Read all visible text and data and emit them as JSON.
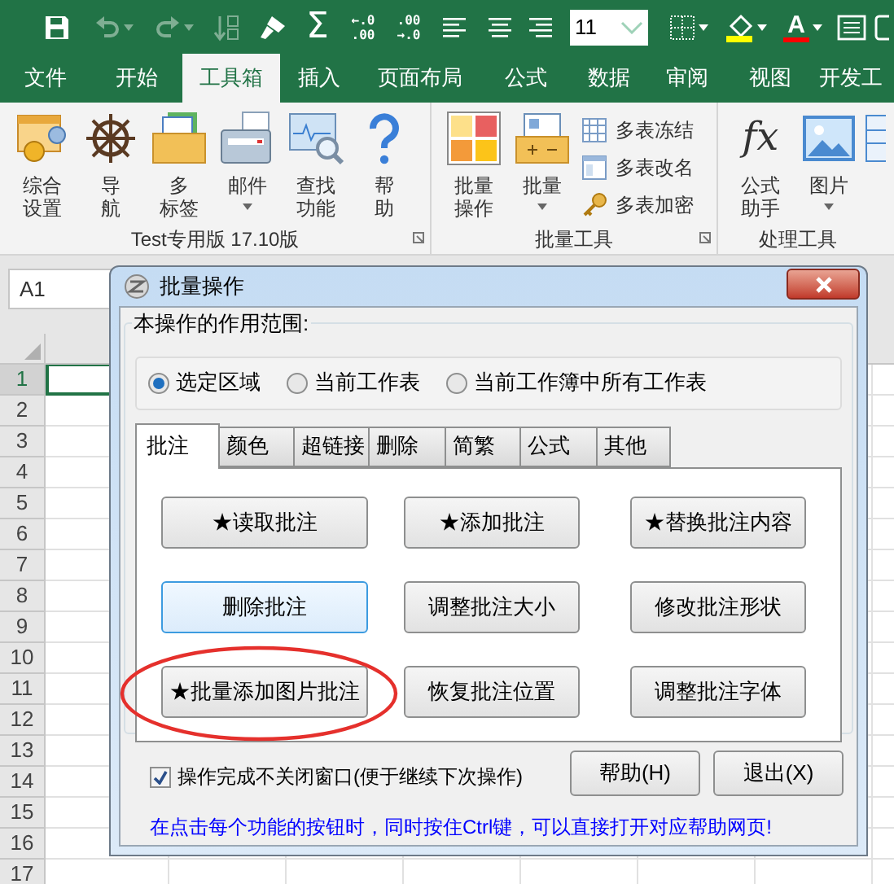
{
  "quick_access": [
    {
      "kind": "save",
      "disabled": false
    },
    {
      "kind": "undo",
      "disabled": true,
      "dropdown": true
    },
    {
      "kind": "redo",
      "disabled": true,
      "dropdown": true
    },
    {
      "kind": "sort",
      "disabled": true
    },
    {
      "kind": "brush",
      "disabled": false
    },
    {
      "kind": "glyph",
      "glyph": "Σ",
      "disabled": false
    },
    {
      "kind": "decimal",
      "lines": [
        "←.0",
        ".00"
      ],
      "disabled": false
    },
    {
      "kind": "decimal",
      "lines": [
        ".00",
        "→.0"
      ],
      "disabled": false
    },
    {
      "kind": "align-left",
      "disabled": false
    },
    {
      "kind": "align-center",
      "disabled": false
    },
    {
      "kind": "align-right",
      "disabled": false
    },
    {
      "kind": "font-size",
      "value": "11"
    },
    {
      "kind": "borders",
      "disabled": false,
      "dropdown": true
    },
    {
      "kind": "fill",
      "disabled": false,
      "dropdown": true
    },
    {
      "kind": "font-color",
      "glyph": "A",
      "disabled": false,
      "dropdown": true
    },
    {
      "kind": "wrap",
      "disabled": false
    },
    {
      "kind": "partial",
      "disabled": false
    }
  ],
  "tabs": [
    {
      "label": "文件",
      "selected": false
    },
    {
      "label": "开始",
      "selected": false
    },
    {
      "label": "工具箱",
      "selected": true
    },
    {
      "label": "插入",
      "selected": false
    },
    {
      "label": "页面布局",
      "selected": false
    },
    {
      "label": "公式",
      "selected": false
    },
    {
      "label": "数据",
      "selected": false
    },
    {
      "label": "审阅",
      "selected": false
    },
    {
      "label": "视图",
      "selected": false
    },
    {
      "label": "开发工",
      "selected": false
    }
  ],
  "ribbon_groups": [
    {
      "label": "Test专用版 17.10版",
      "launcher": true,
      "items": [
        {
          "kind": "large",
          "lines": [
            "综合",
            "设置"
          ]
        },
        {
          "kind": "large",
          "lines": [
            "导",
            "航"
          ]
        },
        {
          "kind": "large",
          "lines": [
            "多",
            "标签"
          ]
        },
        {
          "kind": "large",
          "lines": [
            "邮件"
          ],
          "dropdown": true
        },
        {
          "kind": "large",
          "lines": [
            "查找",
            "功能"
          ]
        },
        {
          "kind": "large",
          "lines": [
            "帮",
            "助"
          ]
        }
      ]
    },
    {
      "label": "批量工具",
      "launcher": true,
      "items": [
        {
          "kind": "large",
          "lines": [
            "批量",
            "操作"
          ]
        },
        {
          "kind": "large",
          "lines": [
            "批量"
          ],
          "dropdown": true
        },
        {
          "kind": "small",
          "label": "多表冻结"
        },
        {
          "kind": "small",
          "label": "多表改名"
        },
        {
          "kind": "small",
          "label": "多表加密"
        }
      ]
    },
    {
      "label": "处理工具",
      "items": [
        {
          "kind": "large",
          "glyph": "fx",
          "lines": [
            "公式",
            "助手"
          ]
        },
        {
          "kind": "large",
          "lines": [
            "图片"
          ],
          "dropdown": true
        },
        {
          "kind": "cut"
        }
      ]
    }
  ],
  "name_box": "A1",
  "sheet": {
    "rows": [
      {
        "label": "1",
        "selected": true
      },
      {
        "label": "2",
        "selected": false
      },
      {
        "label": "3",
        "selected": false
      },
      {
        "label": "4",
        "selected": false
      },
      {
        "label": "5",
        "selected": false
      },
      {
        "label": "6",
        "selected": false
      },
      {
        "label": "7",
        "selected": false
      },
      {
        "label": "8",
        "selected": false
      },
      {
        "label": "9",
        "selected": false
      },
      {
        "label": "10",
        "selected": false
      },
      {
        "label": "11",
        "selected": false
      },
      {
        "label": "12",
        "selected": false
      },
      {
        "label": "13",
        "selected": false
      },
      {
        "label": "14",
        "selected": false
      },
      {
        "label": "15",
        "selected": false
      },
      {
        "label": "16",
        "selected": false
      },
      {
        "label": "17",
        "selected": false
      }
    ]
  },
  "dialog": {
    "title": "批量操作",
    "scope_legend": "本操作的作用范围:",
    "scope_options": [
      {
        "label": "选定区域",
        "selected": true
      },
      {
        "label": "当前工作表",
        "selected": false
      },
      {
        "label": "当前工作簿中所有工作表",
        "selected": false
      }
    ],
    "tabs": [
      {
        "label": "批注",
        "selected": true
      },
      {
        "label": "颜色",
        "selected": false
      },
      {
        "label": "超链接",
        "selected": false
      },
      {
        "label": "删除",
        "selected": false
      },
      {
        "label": "简繁",
        "selected": false
      },
      {
        "label": "公式",
        "selected": false
      },
      {
        "label": "其他",
        "selected": false
      }
    ],
    "buttons": [
      {
        "label": "★读取批注",
        "focused": false,
        "circled": false
      },
      {
        "label": "★添加批注",
        "focused": false,
        "circled": false
      },
      {
        "label": "★替换批注内容",
        "focused": false,
        "circled": false
      },
      {
        "label": "删除批注",
        "focused": true,
        "circled": false
      },
      {
        "label": "调整批注大小",
        "focused": false,
        "circled": false
      },
      {
        "label": "修改批注形状",
        "focused": false,
        "circled": false
      },
      {
        "label": "★批量添加图片批注",
        "focused": false,
        "circled": true
      },
      {
        "label": "恢复批注位置",
        "focused": false,
        "circled": false
      },
      {
        "label": "调整批注字体",
        "focused": false,
        "circled": false
      }
    ],
    "keep_open": {
      "label": "操作完成不关闭窗口(便于继续下次操作)",
      "checked": true
    },
    "actions": [
      "帮助(H)",
      "退出(X)"
    ],
    "hint": "在点击每个功能的按钮时，同时按住Ctrl键，可以直接打开对应帮助网页!"
  }
}
